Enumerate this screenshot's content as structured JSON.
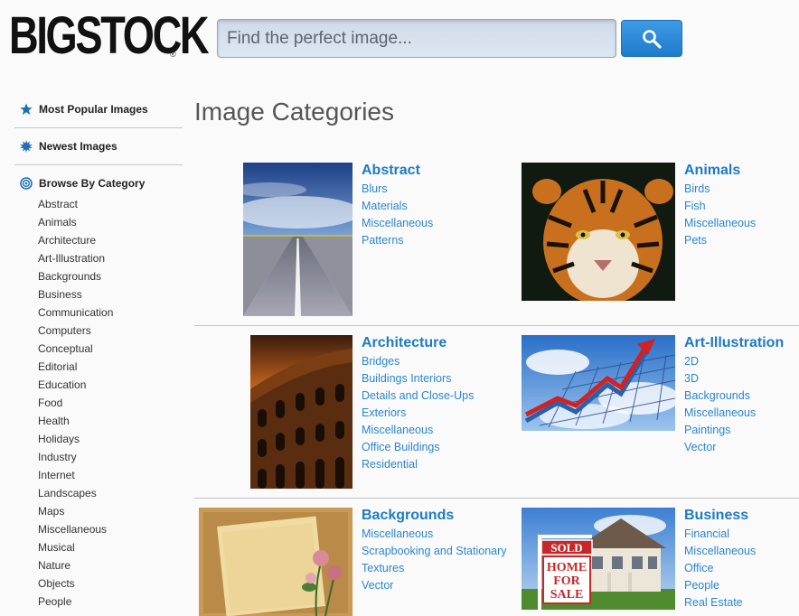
{
  "logo": {
    "text": "BIGSTOCK",
    "mark": "®"
  },
  "search": {
    "placeholder": "Find the perfect image...",
    "button_icon": "search-icon"
  },
  "sidebar": {
    "most_popular": "Most Popular Images",
    "newest": "Newest Images",
    "browse": "Browse By Category",
    "categories": [
      "Abstract",
      "Animals",
      "Architecture",
      "Art-Illustration",
      "Backgrounds",
      "Business",
      "Communication",
      "Computers",
      "Conceptual",
      "Editorial",
      "Education",
      "Food",
      "Health",
      "Holidays",
      "Industry",
      "Internet",
      "Landscapes",
      "Maps",
      "Miscellaneous",
      "Musical",
      "Nature",
      "Objects",
      "People"
    ]
  },
  "main": {
    "title": "Image Categories",
    "categories": [
      {
        "title": "Abstract",
        "links": [
          "Blurs",
          "Materials",
          "Miscellaneous",
          "Patterns"
        ],
        "image": "highway-sky-photo"
      },
      {
        "title": "Animals",
        "links": [
          "Birds",
          "Fish",
          "Miscellaneous",
          "Pets"
        ],
        "image": "tiger-photo"
      },
      {
        "title": "Architecture",
        "links": [
          "Bridges",
          "Buildings Interiors",
          "Details and Close-Ups",
          "Exteriors",
          "Miscellaneous",
          "Office Buildings",
          "Residential"
        ],
        "image": "colosseum-photo"
      },
      {
        "title": "Art-Illustration",
        "links": [
          "2D",
          "3D",
          "Backgrounds",
          "Miscellaneous",
          "Paintings",
          "Vector"
        ],
        "image": "arrow-chart-illustration"
      },
      {
        "title": "Backgrounds",
        "links": [
          "Miscellaneous",
          "Scrapbooking and Stationary",
          "Textures",
          "Vector"
        ],
        "image": "vintage-paper-roses-photo"
      },
      {
        "title": "Business",
        "links": [
          "Financial",
          "Miscellaneous",
          "Office",
          "People",
          "Real Estate"
        ],
        "image": "home-for-sale-photo"
      }
    ]
  },
  "sale_sign": {
    "sold": "SOLD",
    "line1": "HOME",
    "line2": "FOR",
    "line3": "SALE"
  },
  "colors": {
    "link": "#2b86cf",
    "title": "#1e7bc4",
    "search_button": "#1e7bcb"
  }
}
